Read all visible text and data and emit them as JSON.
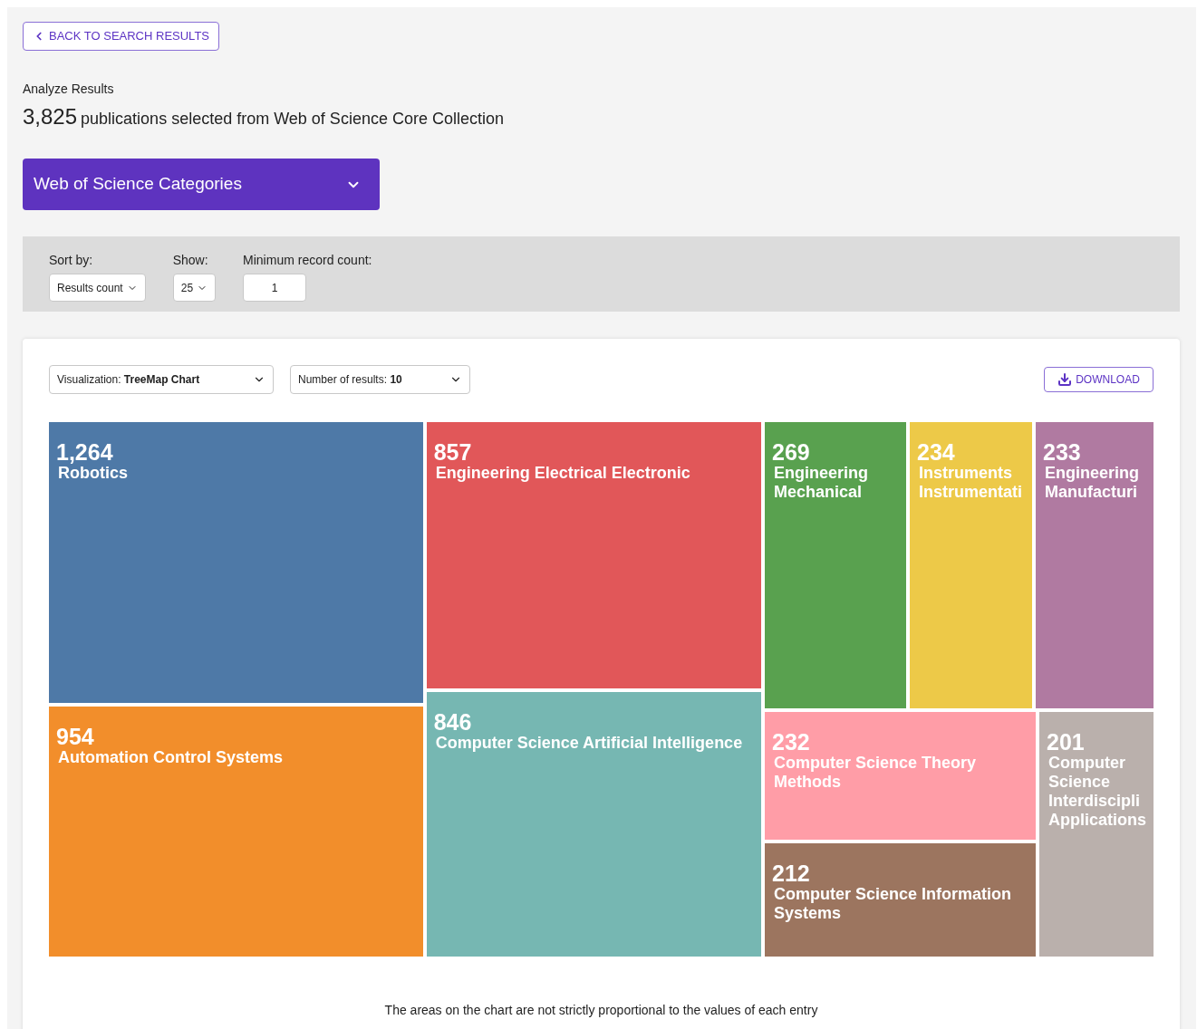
{
  "back_button": {
    "label": "BACK TO SEARCH RESULTS"
  },
  "header": {
    "eyebrow": "Analyze Results",
    "count": "3,825",
    "summary": "publications selected from Web of Science Core Collection"
  },
  "field_select": {
    "label": "Web of Science Categories"
  },
  "filters": [
    {
      "kind": "select",
      "label": "Sort by:",
      "value": "Results count"
    },
    {
      "kind": "select",
      "label": "Show:",
      "value": "25"
    },
    {
      "kind": "input",
      "label": "Minimum record count:",
      "value": "1"
    }
  ],
  "toolbar": {
    "visualization": {
      "label": "Visualization:",
      "value": "TreeMap Chart"
    },
    "results": {
      "label": "Number of results:",
      "value": "10"
    },
    "download": "DOWNLOAD"
  },
  "treemap": [
    {
      "value": "1,264",
      "label": "Robotics",
      "color": "#4e79a7"
    },
    {
      "value": "954",
      "label": "Automation Control Systems",
      "color": "#f28e2b"
    },
    {
      "value": "857",
      "label": "Engineering Electrical Electronic",
      "color": "#e15759"
    },
    {
      "value": "846",
      "label": "Computer Science Artificial Intelligence",
      "color": "#76b7b2"
    },
    {
      "value": "269",
      "label": "Engineering Mechanical",
      "color": "#59a14f"
    },
    {
      "value": "234",
      "label": "Instruments Instrumentati",
      "color": "#edc948"
    },
    {
      "value": "233",
      "label": "Engineering Manufacturi",
      "color": "#b07aa1"
    },
    {
      "value": "232",
      "label": "Computer Science Theory Methods",
      "color": "#ff9da7"
    },
    {
      "value": "212",
      "label": "Computer Science Information Systems",
      "color": "#9c755f"
    },
    {
      "value": "201",
      "label": "Computer Science Interdiscipli Applications",
      "color": "#bab0ac"
    }
  ],
  "footnote": "The areas on the chart are not strictly proportional to the values of each entry"
}
